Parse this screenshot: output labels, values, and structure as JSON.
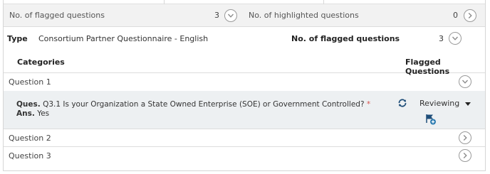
{
  "summary": {
    "flagged_label": "No. of flagged questions",
    "flagged_count": "3",
    "highlighted_label": "No. of highlighted questions",
    "highlighted_count": "0"
  },
  "type_row": {
    "type_label": "Type",
    "type_value": "Consortium Partner Questionnaire - English",
    "flagged_label": "No. of flagged questions",
    "flagged_count": "3"
  },
  "table": {
    "col_categories": "Categories",
    "col_flagged": "Flagged Questions"
  },
  "questions": [
    {
      "label": "Question 1"
    },
    {
      "label": "Question 2"
    },
    {
      "label": "Question 3"
    }
  ],
  "detail": {
    "ques_label": "Ques.",
    "ques_text": "Q3.1 Is your Organization a State Owned Enterprise (SOE) or Government Controlled?",
    "required_mark": "*",
    "ans_label": "Ans.",
    "ans_text": "Yes",
    "status": "Reviewing"
  },
  "colors": {
    "accent": "#1f4e79",
    "summary_bg": "#f2f2f2",
    "detail_bg": "#edf0f2",
    "required": "#d9534f",
    "plus_badge": "#2a7ab0"
  },
  "icons": [
    "chevron-down-icon",
    "chevron-right-icon",
    "refresh-icon",
    "caret-down-icon",
    "flag-add-icon"
  ]
}
